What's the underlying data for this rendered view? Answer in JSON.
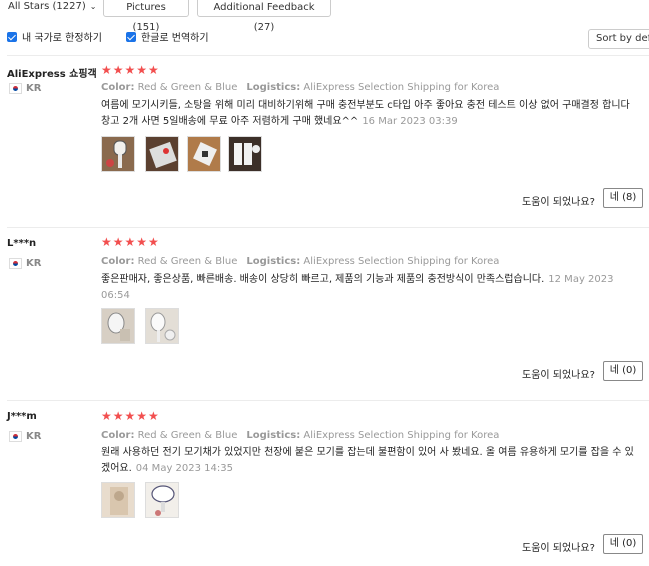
{
  "filters": {
    "all_stars": "All Stars (1227)",
    "pictures": "Pictures (151)",
    "additional_feedback": "Additional Feedback (27)"
  },
  "options": {
    "my_country_only": "내 국가로 한정하기",
    "translate_korean": "한글로 번역하기",
    "sort": "Sort by default"
  },
  "reviews": [
    {
      "name": "AliExpress 쇼핑객",
      "country": "KR",
      "stars": "★★★★★",
      "color_label": "Color:",
      "color_value": "Red & Green & Blue",
      "logistics_label": "Logistics:",
      "logistics_value": "AliExpress Selection Shipping for Korea",
      "text": "여름에 모기시키들, 소탕을 위해 미리 대비하기위해 구매 충전부분도 c타입 아주 좋아요 충전 테스트 이상 없어 구매결정 합니다 창고 2개 사면 5일배송에 무료 아주 저렴하게 구매 했네요^^",
      "date": "16 Mar 2023 03:39",
      "helpful_label": "도움이 되었나요?",
      "yes_label": "네 (8)",
      "rating": 5
    },
    {
      "name": "L***n",
      "country": "KR",
      "stars": "★★★★★",
      "color_label": "Color:",
      "color_value": "Red & Green & Blue",
      "logistics_label": "Logistics:",
      "logistics_value": "AliExpress Selection Shipping for Korea",
      "text": "좋은판매자, 좋은상품, 빠른배송. 배송이 상당히 빠르고, 제품의 기능과 제품의 충전방식이 만족스럽습니다.",
      "date": "12 May 2023 06:54",
      "helpful_label": "도움이 되었나요?",
      "yes_label": "네 (0)",
      "rating": 5
    },
    {
      "name": "J***m",
      "country": "KR",
      "stars": "★★★★★",
      "color_label": "Color:",
      "color_value": "Red & Green & Blue",
      "logistics_label": "Logistics:",
      "logistics_value": "AliExpress Selection Shipping for Korea",
      "text": "원래 사용하던 전기 모기채가 있었지만 천장에 붙은 모기를 잡는데 불편함이 있어 사 봤네요. 올 여름 유용하게 모기를 잡을 수 있겠어요.",
      "date": "04 May 2023 14:35",
      "helpful_label": "도움이 되었나요?",
      "yes_label": "네 (0)",
      "rating": 5
    }
  ],
  "colors": {
    "star": "#f24f4f",
    "checkbox": "#1a73e8",
    "muted": "#999999"
  }
}
